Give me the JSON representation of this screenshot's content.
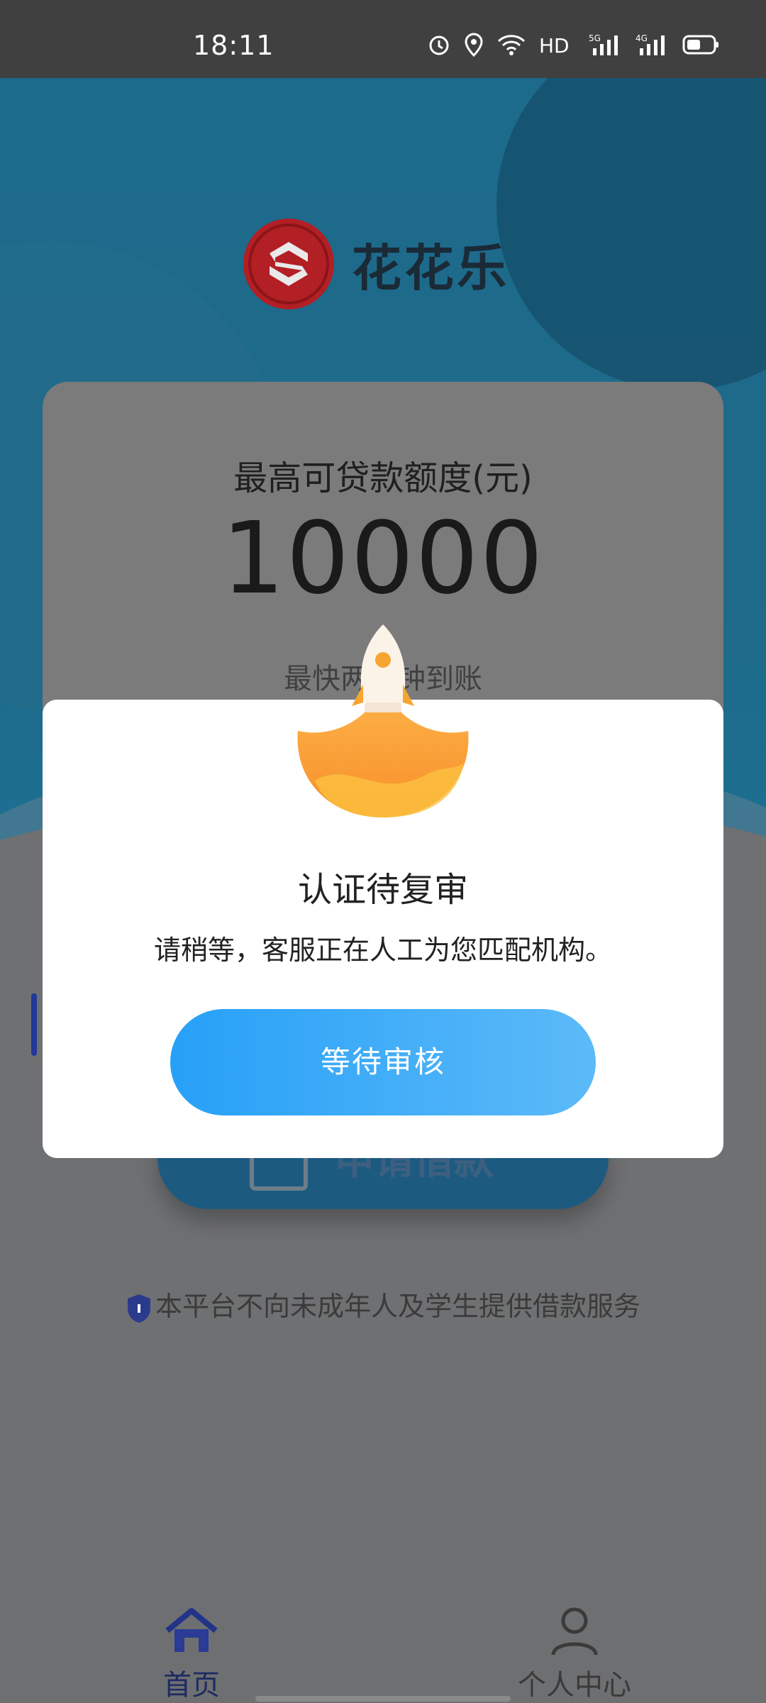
{
  "status_bar": {
    "time": "18:11"
  },
  "app": {
    "brand_name": "花花乐"
  },
  "card": {
    "label": "最高可贷款额度(元)",
    "amount": "10000",
    "subtitle": "最快两分钟到账"
  },
  "apply_button": {
    "label": "申请借款"
  },
  "notice": "本平台不向未成年人及学生提供借款服务",
  "tabs": [
    {
      "label": "首页"
    },
    {
      "label": "个人中心"
    }
  ],
  "modal": {
    "title": "认证待复审",
    "message": "请稍等，客服正在人工为您匹配机构。",
    "button_label": "等待审核"
  },
  "colors": {
    "primary_blue": "#27a0f7",
    "brand_red": "#b21f24",
    "rocket_orange": "#f7a531"
  }
}
